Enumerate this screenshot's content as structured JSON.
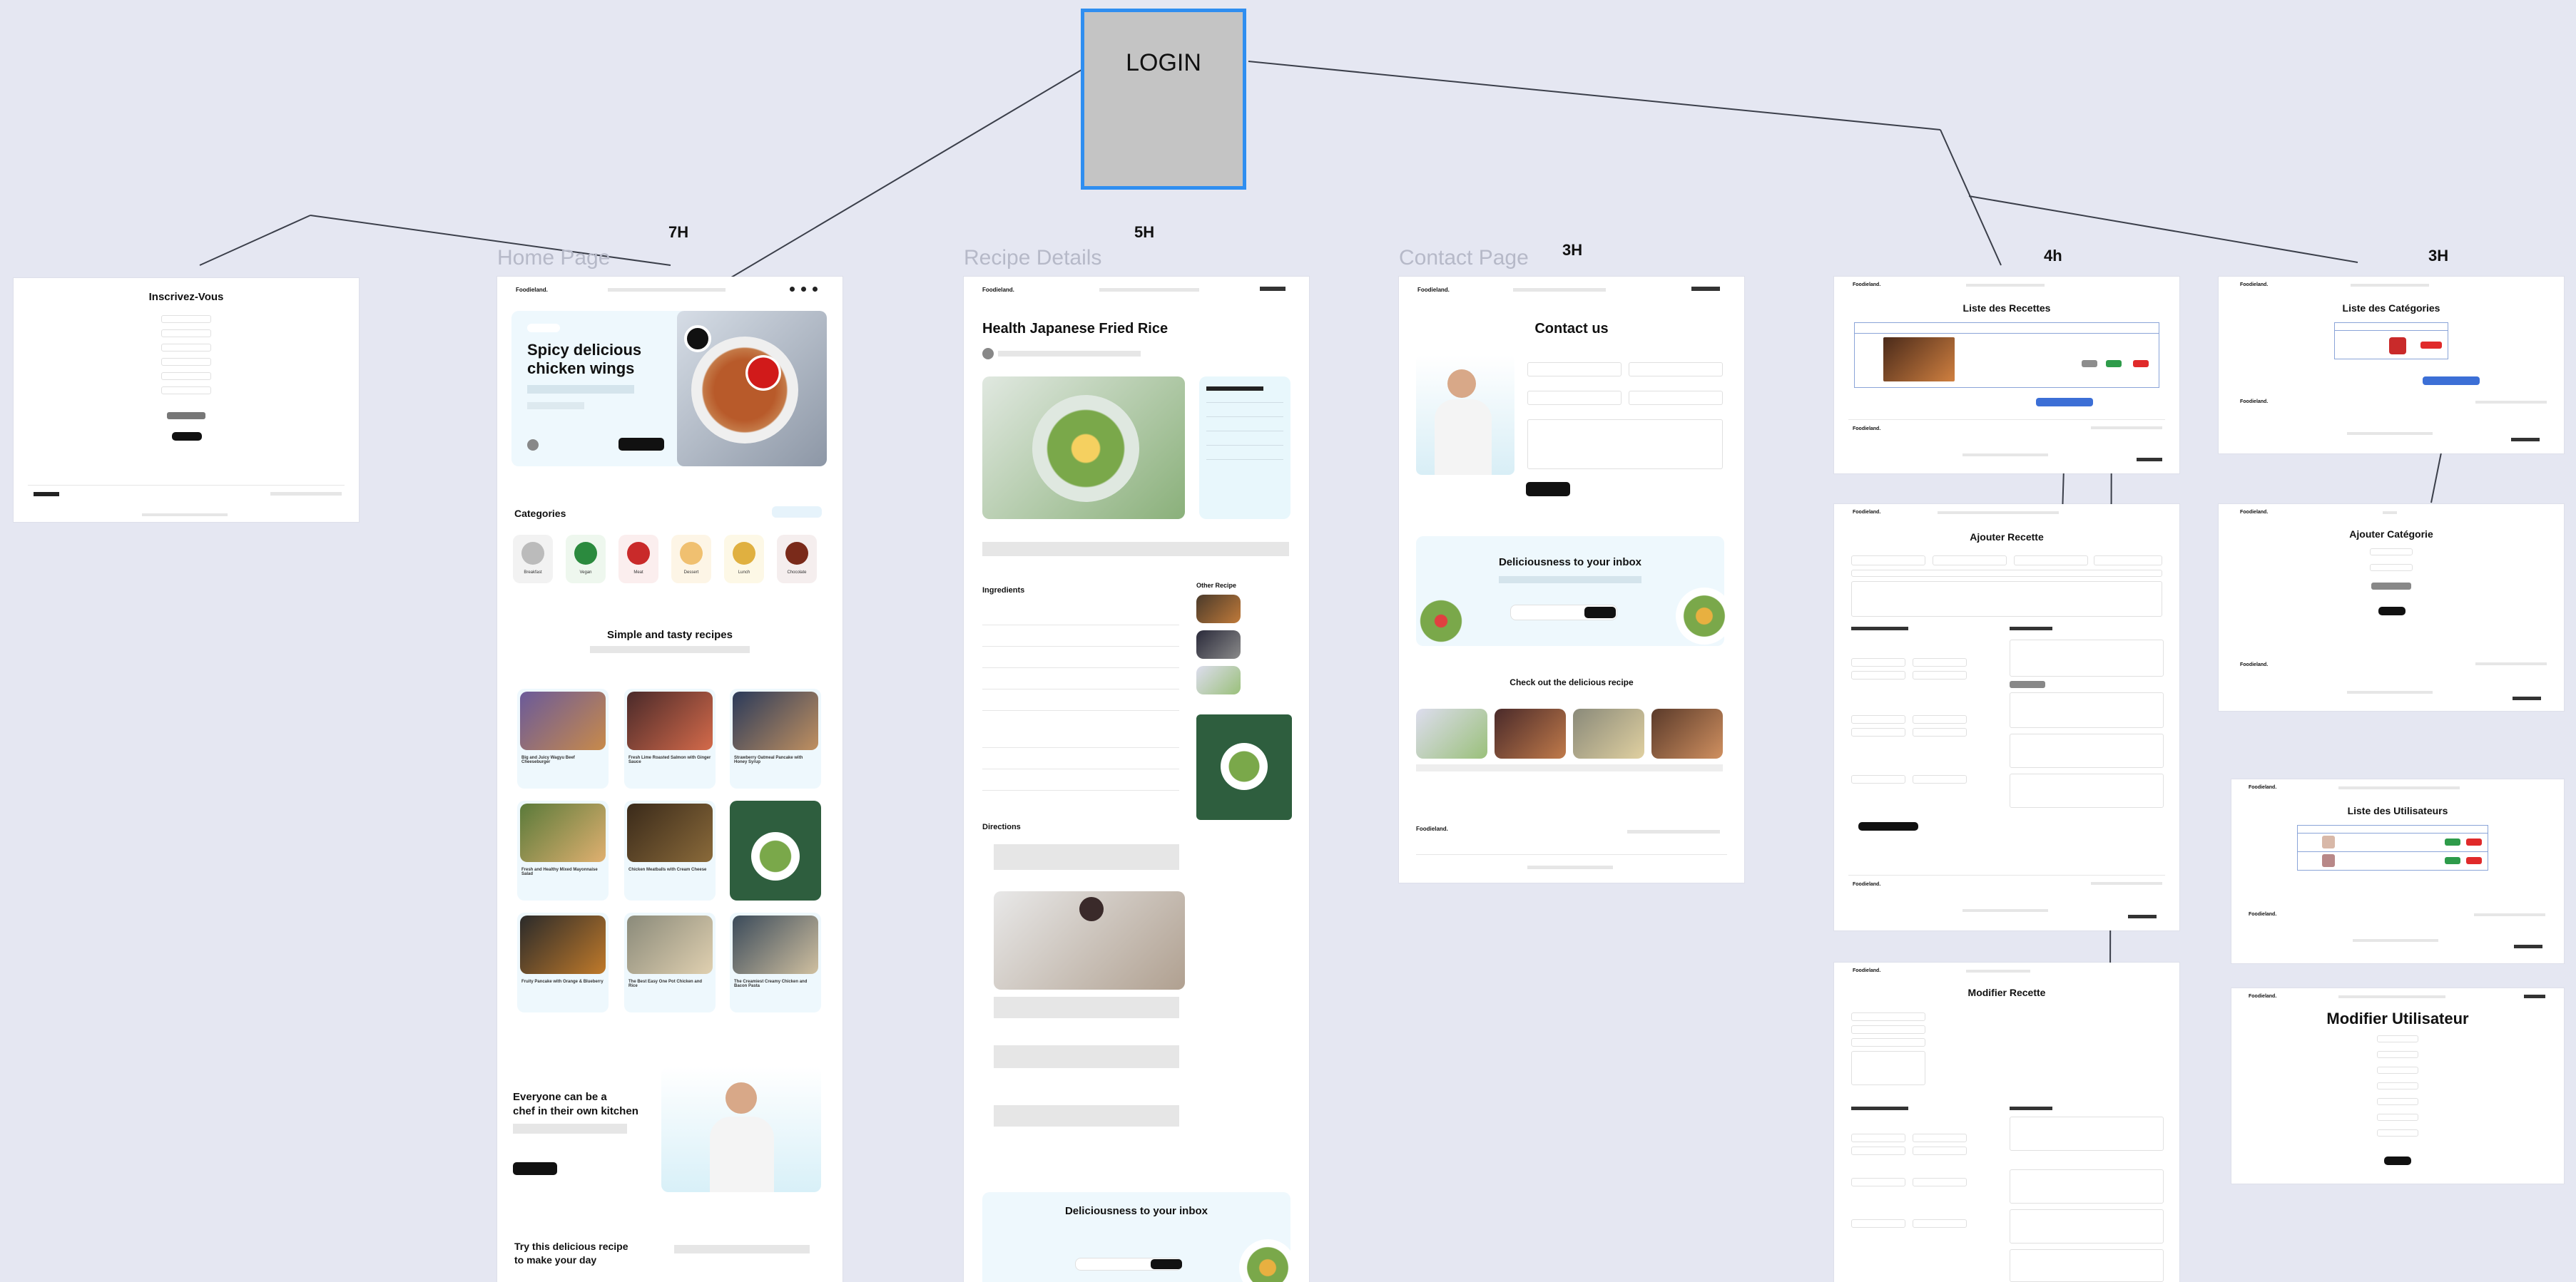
{
  "login": {
    "label": "LOGIN"
  },
  "frames": {
    "signup": {
      "title": "Inscrivez-Vous"
    },
    "home": {
      "label": "Home Page",
      "hours": "7H"
    },
    "recipe": {
      "label": "Recipe Details",
      "hours": "5H",
      "title": "Health Japanese Fried Rice"
    },
    "contact": {
      "label": "Contact Page",
      "hours": "3H",
      "title": "Contact us"
    },
    "recettes_list": {
      "hours": "4h",
      "title": "Liste des Recettes"
    },
    "categories_list": {
      "hours": "3H",
      "title": "Liste des Catégories"
    },
    "add_recette": {
      "title": "Ajouter Recette"
    },
    "add_categorie": {
      "title": "Ajouter Catégorie"
    },
    "users_list": {
      "title": "Liste des Utilisateurs"
    },
    "edit_recette": {
      "title": "Modifier Recette"
    },
    "edit_user": {
      "title": "Modifier Utilisateur"
    }
  },
  "home": {
    "hero_title_1": "Spicy delicious",
    "hero_title_2": "chicken wings",
    "categories_title": "Categories",
    "categories": [
      "Breakfast",
      "Vegan",
      "Meat",
      "Dessert",
      "Lunch",
      "Chocolate"
    ],
    "recipes_title": "Simple and tasty recipes",
    "recipes": [
      "Big and Juicy Wagyu Beef Cheeseburger",
      "Fresh Lime Roasted Salmon with Ginger Sauce",
      "Strawberry Oatmeal Pancake with Honey Syrup",
      "Fresh and Healthy Mixed Mayonnaise Salad",
      "Chicken Meatballs with Cream Cheese",
      "Fruity Pancake with Orange & Blueberry",
      "The Best Easy One Pot Chicken and Rice",
      "The Creamiest Creamy Chicken and Bacon Pasta"
    ],
    "chef_title_1": "Everyone can be a",
    "chef_title_2": "chef in their own kitchen",
    "try_title_1": "Try this delicious recipe",
    "try_title_2": "to make your day"
  },
  "recipe": {
    "ingredients": "Ingredients",
    "other_recipe": "Other Recipe",
    "directions": "Directions",
    "inbox": "Deliciousness to your inbox"
  },
  "contact": {
    "inbox": "Deliciousness to your inbox",
    "check": "Check out the delicious recipe"
  }
}
